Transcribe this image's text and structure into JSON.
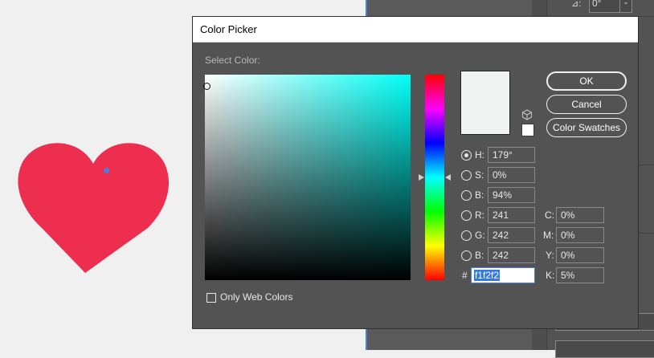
{
  "dialog": {
    "title": "Color Picker",
    "select_label": "Select Color:",
    "buttons": {
      "ok": "OK",
      "cancel": "Cancel",
      "swatches": "Color Swatches"
    },
    "web_colors_label": "Only Web Colors",
    "web_colors_checked": false,
    "current_color": "#f1f2f2",
    "hue_color": "#00fff7",
    "hsb": [
      {
        "label": "H:",
        "value": "179°",
        "checked": true
      },
      {
        "label": "S:",
        "value": "0%",
        "checked": false
      },
      {
        "label": "B:",
        "value": "94%",
        "checked": false
      }
    ],
    "rgb": [
      {
        "label": "R:",
        "value": "241",
        "checked": false
      },
      {
        "label": "G:",
        "value": "242",
        "checked": false
      },
      {
        "label": "B:",
        "value": "242",
        "checked": false
      }
    ],
    "hex_prefix": "#",
    "hex": "f1f2f2",
    "cmyk": [
      {
        "label": "C:",
        "value": "0%"
      },
      {
        "label": "M:",
        "value": "0%"
      },
      {
        "label": "Y:",
        "value": "0%"
      },
      {
        "label": "K:",
        "value": "5%"
      }
    ]
  },
  "background": {
    "heart_color": "#ee2e4e",
    "angle_value": "0°"
  }
}
